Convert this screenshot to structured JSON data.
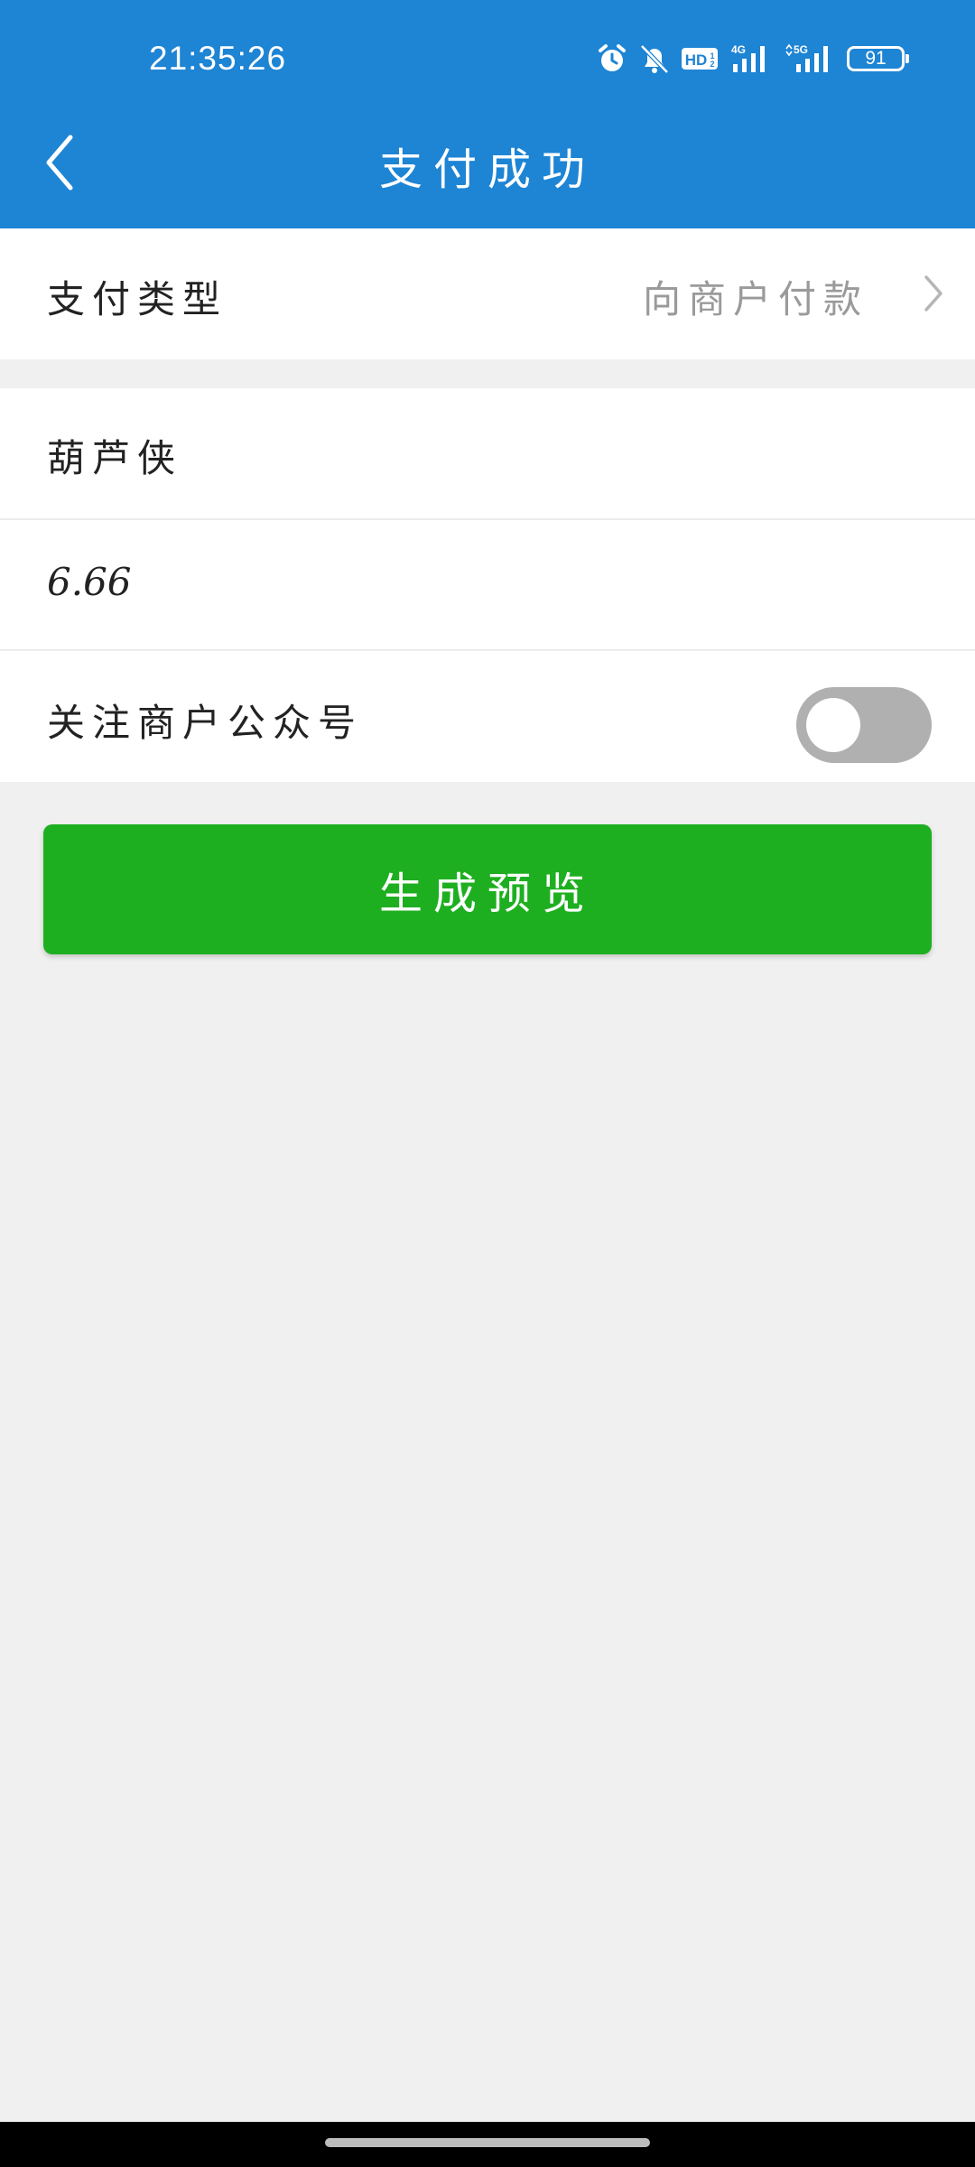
{
  "status_bar": {
    "time": "21:35:26",
    "battery_level": "91",
    "network_4g": "4G",
    "network_5g": "5G",
    "hd_badge": "HD",
    "icons": [
      "alarm-icon",
      "bell-off-icon",
      "hd-voice-icon",
      "signal-4g-icon",
      "signal-5g-icon",
      "battery-icon"
    ]
  },
  "header": {
    "title": "支付成功",
    "back_icon": "chevron-left-icon",
    "background_color": "#1e84d4"
  },
  "payment_type": {
    "label": "支付类型",
    "value": "向商户付款",
    "chevron_icon": "chevron-right-icon"
  },
  "form": {
    "merchant_name": "葫芦侠",
    "amount": "6.66",
    "follow_label": "关注商户公众号",
    "follow_enabled": false
  },
  "actions": {
    "preview_label": "生成预览",
    "preview_color": "#1eaf20"
  }
}
